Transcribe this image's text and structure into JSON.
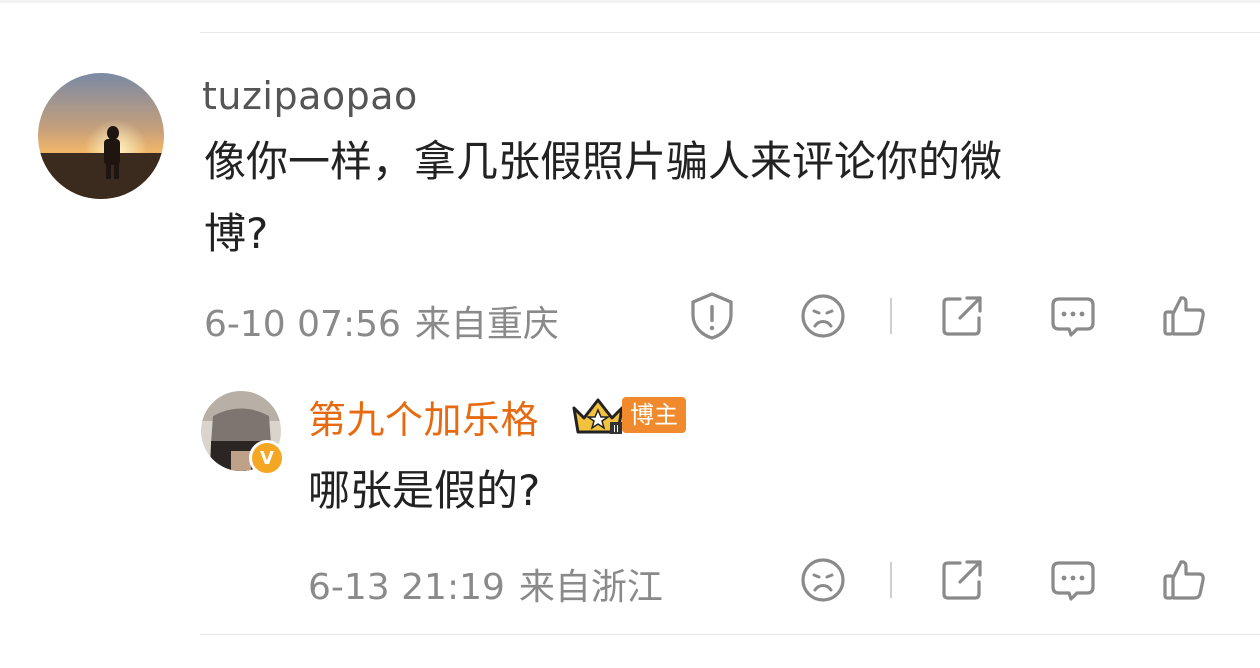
{
  "comment": {
    "username": "tuzipaopao",
    "text_line1": "像你一样，拿几张假照片骗人来评论你的微",
    "text_line2": "博?",
    "date": "6-10 07:56",
    "location": "来自重庆"
  },
  "reply": {
    "username": "第九个加乐格",
    "badge_label": "博主",
    "verified_mark": "V",
    "text": "哪张是假的?",
    "date": "6-13 21:19",
    "location": "来自浙江"
  },
  "icons": {
    "report": "report-icon",
    "dislike": "dislike-face-icon",
    "share": "share-icon",
    "comment": "comment-icon",
    "like": "thumbs-up-icon"
  },
  "colors": {
    "host_orange": "#e86a10",
    "icon_gray": "#8a8a8a"
  }
}
